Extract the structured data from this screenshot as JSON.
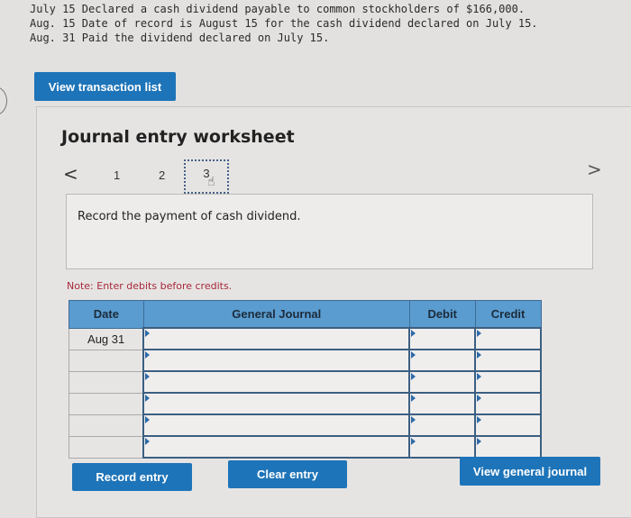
{
  "problem": {
    "lines": [
      "July 15 Declared a cash dividend payable to common stockholders of $166,000.",
      "Aug. 15 Date of record is August 15 for the cash dividend declared on July 15.",
      "Aug. 31 Paid the dividend declared on July 15."
    ]
  },
  "buttons": {
    "view_transaction_list": "View transaction list",
    "record_entry": "Record entry",
    "clear_entry": "Clear entry",
    "view_general_journal": "View general journal"
  },
  "worksheet": {
    "title": "Journal entry worksheet",
    "nav": {
      "prev": "<",
      "next": ">"
    },
    "steps": [
      "1",
      "2",
      "3"
    ],
    "active_step": "3",
    "instruction": "Record the payment of cash dividend.",
    "note": "Note: Enter debits before credits."
  },
  "journal": {
    "headers": [
      "Date",
      "General Journal",
      "Debit",
      "Credit"
    ],
    "rows": [
      {
        "date": "Aug 31",
        "account": "",
        "debit": "",
        "credit": ""
      },
      {
        "date": "",
        "account": "",
        "debit": "",
        "credit": ""
      },
      {
        "date": "",
        "account": "",
        "debit": "",
        "credit": ""
      },
      {
        "date": "",
        "account": "",
        "debit": "",
        "credit": ""
      },
      {
        "date": "",
        "account": "",
        "debit": "",
        "credit": ""
      },
      {
        "date": "",
        "account": "",
        "debit": "",
        "credit": ""
      }
    ]
  }
}
